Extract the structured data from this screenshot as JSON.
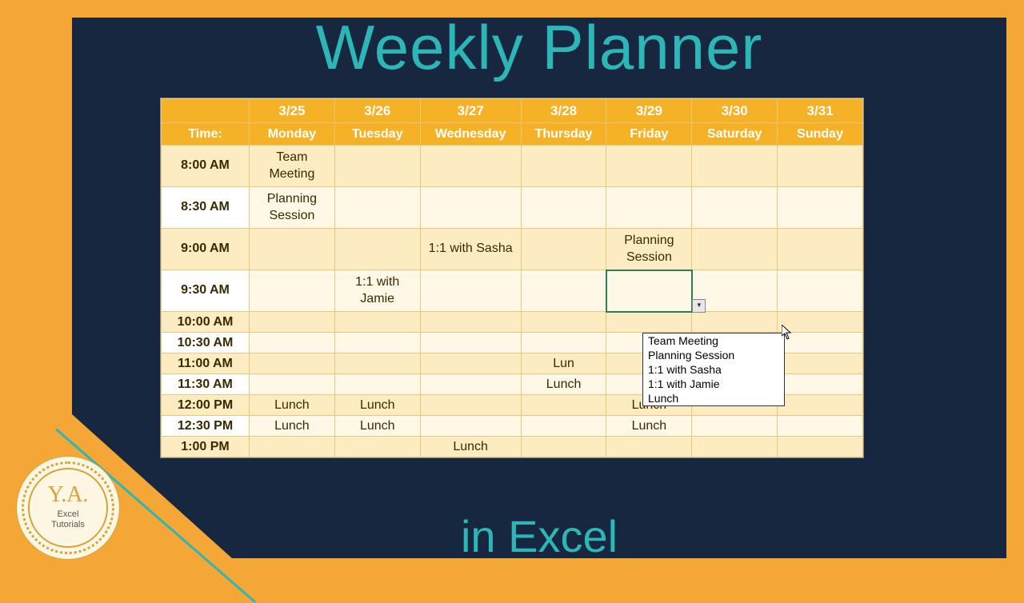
{
  "title_top": "Weekly Planner",
  "title_bottom": "in Excel",
  "badge": {
    "initials": "Y.A.",
    "line1": "Excel",
    "line2": "Tutorials"
  },
  "header_dates": [
    "",
    "3/25",
    "3/26",
    "3/27",
    "3/28",
    "3/29",
    "3/30",
    "3/31"
  ],
  "header_days": [
    "Time:",
    "Monday",
    "Tuesday",
    "Wednesday",
    "Thursday",
    "Friday",
    "Saturday",
    "Sunday"
  ],
  "rows": [
    {
      "time": "8:00 AM",
      "tall": true,
      "cells": [
        "Team Meeting",
        "",
        "",
        "",
        "",
        "",
        ""
      ]
    },
    {
      "time": "8:30 AM",
      "tall": true,
      "cells": [
        "Planning Session",
        "",
        "",
        "",
        "",
        "",
        ""
      ]
    },
    {
      "time": "9:00 AM",
      "tall": true,
      "cells": [
        "",
        "",
        "1:1 with Sasha",
        "",
        "Planning Session",
        "",
        ""
      ]
    },
    {
      "time": "9:30 AM",
      "tall": true,
      "cells": [
        "",
        "1:1 with Jamie",
        "",
        "",
        "",
        "",
        ""
      ],
      "selected_col": 4
    },
    {
      "time": "10:00 AM",
      "tall": false,
      "cells": [
        "",
        "",
        "",
        "",
        "",
        "",
        ""
      ]
    },
    {
      "time": "10:30 AM",
      "tall": false,
      "cells": [
        "",
        "",
        "",
        "",
        "",
        "",
        ""
      ]
    },
    {
      "time": "11:00 AM",
      "tall": false,
      "cells": [
        "",
        "",
        "",
        "Lun",
        "",
        "",
        ""
      ]
    },
    {
      "time": "11:30 AM",
      "tall": false,
      "cells": [
        "",
        "",
        "",
        "Lunch",
        "",
        "",
        ""
      ]
    },
    {
      "time": "12:00 PM",
      "tall": false,
      "cells": [
        "Lunch",
        "Lunch",
        "",
        "",
        "Lunch",
        "",
        ""
      ]
    },
    {
      "time": "12:30 PM",
      "tall": false,
      "cells": [
        "Lunch",
        "Lunch",
        "",
        "",
        "Lunch",
        "",
        ""
      ]
    },
    {
      "time": "1:00 PM",
      "tall": false,
      "cells": [
        "",
        "",
        "Lunch",
        "",
        "",
        "",
        ""
      ]
    }
  ],
  "dropdown_options": [
    "Team Meeting",
    "Planning Session",
    "1:1 with Sasha",
    "1:1 with Jamie",
    "Lunch"
  ],
  "dd_arrow_glyph": "▼"
}
